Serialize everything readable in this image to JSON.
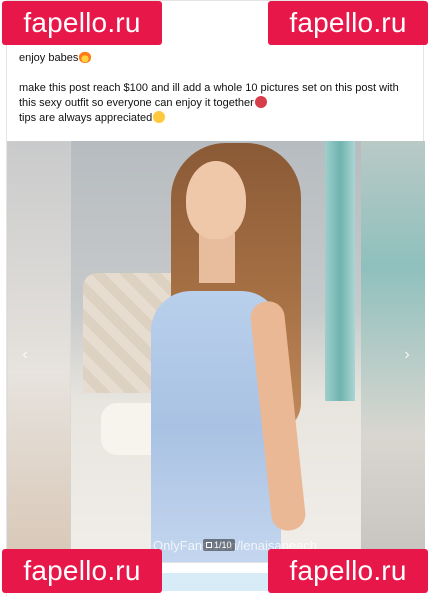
{
  "watermark_badges": {
    "top_left": "fapello.ru",
    "top_right": "fapello.ru",
    "bottom_left": "fapello.ru",
    "bottom_right": "fapello.ru"
  },
  "post": {
    "caption_line_1": "enjoy babes",
    "caption_line_2": "make this post reach $100 and ill add a whole 10 pictures set on this post with this sexy outfit so everyone can enjoy it together",
    "caption_line_3": "tips are always appreciated",
    "emojis": [
      "fire-emoji",
      "devil-emoji",
      "kiss-emoji"
    ]
  },
  "media": {
    "counter": "1/10",
    "watermark_text": "OnlyFans.com/lenaisapeach",
    "prev_arrow": "‹",
    "next_arrow": "›"
  },
  "colors": {
    "badge": "#e8174a",
    "dress": "#b9d0ec"
  }
}
